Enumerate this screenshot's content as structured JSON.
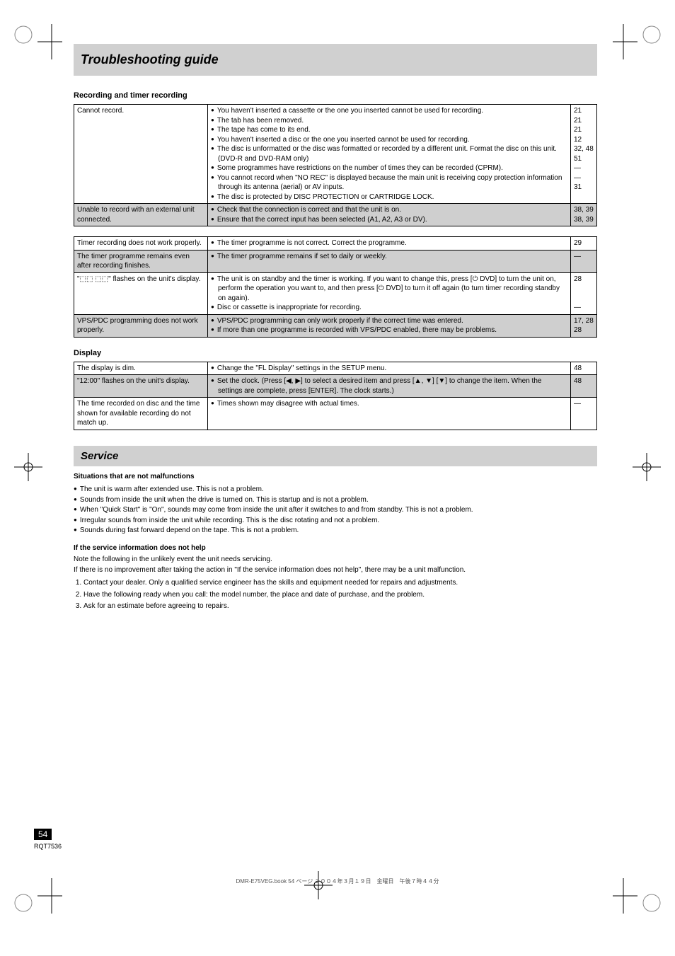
{
  "title": "Troubleshooting guide",
  "sections": {
    "recording": {
      "label": "Recording and timer recording",
      "rows": [
        {
          "shade": false,
          "left": "Cannot record.",
          "bullets": [
            "You haven't inserted a cassette or the one you inserted cannot be used for recording.",
            "The tab has been removed.",
            "The tape has come to its end.",
            "You haven't inserted a disc or the one you inserted cannot be used for recording.",
            "The disc is unformatted or the disc was formatted or recorded by a different unit. Format the disc on this unit. (DVD-R and DVD-RAM only)",
            "",
            "Some programmes have restrictions on the number of times they can be recorded (CPRM).",
            "You cannot record when \"NO REC\" is displayed because the main unit is receiving copy protection information through its antenna (aerial) or AV inputs.",
            "The disc is protected by DISC PROTECTION or CARTRIDGE LOCK."
          ],
          "refs": "21\n21\n21\n12\n32, 48\n51\n—\n—\n31"
        },
        {
          "shade": true,
          "left": "Unable to record with an external unit connected.",
          "bullets": [
            "Check that the connection is correct and that the unit is on.",
            "Ensure that the correct input has been selected (A1, A2, A3 or DV)."
          ],
          "refs": "38, 39\n38, 39"
        }
      ]
    },
    "timer": {
      "rows": [
        {
          "shade": false,
          "left": "Timer recording does not work properly.",
          "bullets": [
            "The timer programme is not correct. Correct the programme."
          ],
          "refs": "29"
        },
        {
          "shade": true,
          "left": "The timer programme remains even after recording finishes.",
          "bullets": [
            "The timer programme remains if set to daily or weekly."
          ],
          "refs": "—"
        },
        {
          "shade": false,
          "left": "\"⬚⬚ ⬚⬚\" flashes on the unit's display.",
          "bullets": [
            "The unit is on standby and the timer is working. If you want to change this, press [⏻ DVD] to turn the unit on, perform the operation you want to, and then press [⏻ DVD] to turn it off again (to turn timer recording standby on again).",
            "Disc or cassette is inappropriate for recording."
          ],
          "refs": "28\n\n\n—"
        },
        {
          "shade": true,
          "left": "VPS/PDC programming does not work properly.",
          "bullets": [
            "VPS/PDC programming can only work properly if the correct time was entered.",
            "If more than one programme is recorded with VPS/PDC enabled, there may be problems."
          ],
          "refs": "17, 28\n28"
        }
      ]
    },
    "display": {
      "label": "Display",
      "rows": [
        {
          "shade": false,
          "left": "The display is dim.",
          "bullets": [
            "Change the \"FL Display\" settings in the SETUP menu."
          ],
          "refs": "48"
        },
        {
          "shade": true,
          "left": "\"12:00\" flashes on the unit's display.",
          "bullets": [
            "Set the clock. (Press [◀, ▶] to select a desired item and press [▲, ▼] [▼] to change the item. When the settings are complete, press [ENTER]. The clock starts.)"
          ],
          "refs": "48"
        },
        {
          "shade": false,
          "left": "The time recorded on disc and the time shown for available recording do not match up.",
          "bullets": [
            "Times shown may disagree with actual times."
          ],
          "refs": "—"
        }
      ]
    }
  },
  "service": {
    "title": "Service",
    "label": "Situations that are not malfunctions",
    "bullets": [
      "The unit is warm after extended use. This is not a problem.",
      "Sounds from inside the unit when the drive is turned on. This is startup and is not a problem.",
      "When \"Quick Start\" is \"On\", sounds may come from inside the unit after it switches to and from standby. This is not a problem.",
      "Irregular sounds from inside the unit while recording. This is the disc rotating and not a problem.",
      "Sounds during fast forward depend on the tape. This is not a problem."
    ],
    "bottom_label": "If the service information does not help",
    "body": "Note the following in the unlikely event the unit needs servicing.\nIf there is no improvement after taking the action in \"If the service information does not help\", there may be a unit malfunction.",
    "steps": [
      "Contact your dealer. Only a qualified service engineer has the skills and equipment needed for repairs and adjustments.",
      "Have the following ready when you call: the model number, the place and date of purchase, and the problem.",
      "Ask for an estimate before agreeing to repairs."
    ]
  },
  "footer": {
    "page": "54",
    "rqt": "RQT7536"
  },
  "footnote": "DMR-E75VEG.book  54 ページ  ２００４年３月１９日　金曜日　午後７時４４分"
}
